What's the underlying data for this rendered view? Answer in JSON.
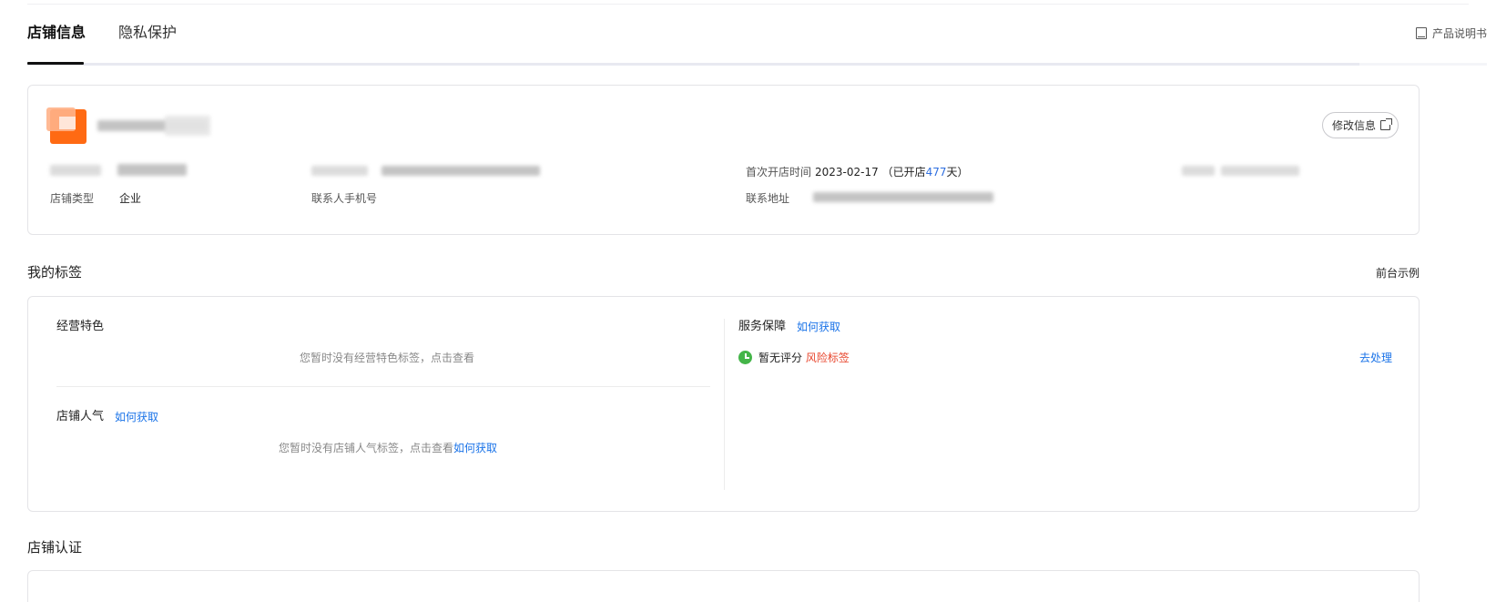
{
  "tabs": {
    "items": [
      {
        "label": "店铺信息",
        "active": true
      },
      {
        "label": "隐私保护",
        "active": false
      }
    ],
    "manual_label": "产品说明书"
  },
  "store_info": {
    "edit_label": "修改信息",
    "open_time_label": "首次开店时间",
    "open_date": "2023-02-17",
    "open_prefix": "（已开店",
    "open_days": "477",
    "open_suffix": "天）",
    "type_label": "店铺类型",
    "type_value": "企业",
    "phone_label": "联系人手机号",
    "address_label": "联系地址"
  },
  "tags": {
    "section_title": "我的标签",
    "example_link": "前台示例",
    "business_title": "经营特色",
    "business_empty": "您暂时没有经营特色标签，点击查看",
    "popularity_title": "店铺人气",
    "popularity_link": "如何获取",
    "popularity_empty": "您暂时没有店铺人气标签，点击查看",
    "popularity_empty_link": "如何获取",
    "service_title": "服务保障",
    "service_link": "如何获取",
    "no_rating": "暂无评分",
    "risk_label": "风险标签",
    "handle_link": "去处理"
  },
  "cert": {
    "section_title": "店铺认证"
  },
  "colors": {
    "accent_blue": "#1a73e8",
    "risk_red": "#e8452c",
    "status_green": "#44b549",
    "logo_orange": "#ff6a13"
  }
}
